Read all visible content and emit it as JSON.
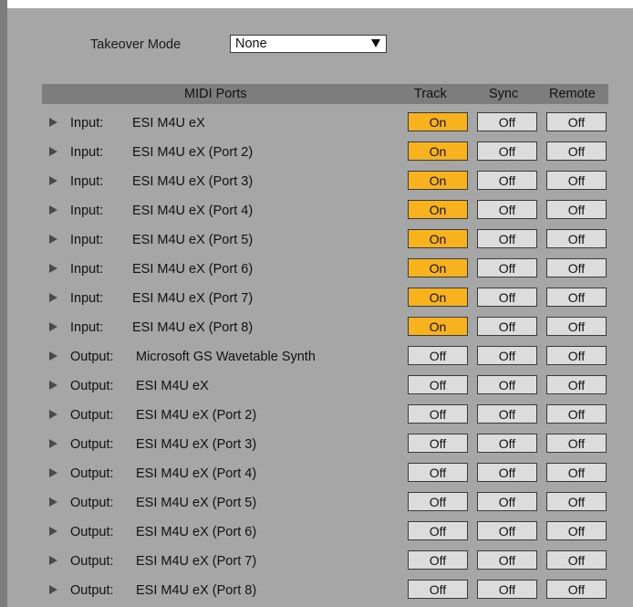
{
  "takeover": {
    "label": "Takeover Mode",
    "value": "None"
  },
  "header": {
    "ports": "MIDI Ports",
    "track": "Track",
    "sync": "Sync",
    "remote": "Remote"
  },
  "colors": {
    "on": "#f7b21e",
    "off": "#dcdcdc",
    "header": "#7d7d7d",
    "panel": "#a6a6a6"
  },
  "ports": [
    {
      "kind": "Input:",
      "name": "ESI M4U eX",
      "track": "On",
      "sync": "Off",
      "remote": "Off"
    },
    {
      "kind": "Input:",
      "name": "ESI M4U eX (Port 2)",
      "track": "On",
      "sync": "Off",
      "remote": "Off"
    },
    {
      "kind": "Input:",
      "name": "ESI M4U eX (Port 3)",
      "track": "On",
      "sync": "Off",
      "remote": "Off"
    },
    {
      "kind": "Input:",
      "name": "ESI M4U eX (Port 4)",
      "track": "On",
      "sync": "Off",
      "remote": "Off"
    },
    {
      "kind": "Input:",
      "name": "ESI M4U eX (Port 5)",
      "track": "On",
      "sync": "Off",
      "remote": "Off"
    },
    {
      "kind": "Input:",
      "name": "ESI M4U eX (Port 6)",
      "track": "On",
      "sync": "Off",
      "remote": "Off"
    },
    {
      "kind": "Input:",
      "name": "ESI M4U eX (Port 7)",
      "track": "On",
      "sync": "Off",
      "remote": "Off"
    },
    {
      "kind": "Input:",
      "name": "ESI M4U eX (Port 8)",
      "track": "On",
      "sync": "Off",
      "remote": "Off"
    },
    {
      "kind": "Output:",
      "name": "Microsoft GS Wavetable Synth",
      "track": "Off",
      "sync": "Off",
      "remote": "Off"
    },
    {
      "kind": "Output:",
      "name": "ESI M4U eX",
      "track": "Off",
      "sync": "Off",
      "remote": "Off"
    },
    {
      "kind": "Output:",
      "name": "ESI M4U eX (Port 2)",
      "track": "Off",
      "sync": "Off",
      "remote": "Off"
    },
    {
      "kind": "Output:",
      "name": "ESI M4U eX (Port 3)",
      "track": "Off",
      "sync": "Off",
      "remote": "Off"
    },
    {
      "kind": "Output:",
      "name": "ESI M4U eX (Port 4)",
      "track": "Off",
      "sync": "Off",
      "remote": "Off"
    },
    {
      "kind": "Output:",
      "name": "ESI M4U eX (Port 5)",
      "track": "Off",
      "sync": "Off",
      "remote": "Off"
    },
    {
      "kind": "Output:",
      "name": "ESI M4U eX (Port 6)",
      "track": "Off",
      "sync": "Off",
      "remote": "Off"
    },
    {
      "kind": "Output:",
      "name": "ESI M4U eX (Port 7)",
      "track": "Off",
      "sync": "Off",
      "remote": "Off"
    },
    {
      "kind": "Output:",
      "name": "ESI M4U eX (Port 8)",
      "track": "Off",
      "sync": "Off",
      "remote": "Off"
    }
  ]
}
